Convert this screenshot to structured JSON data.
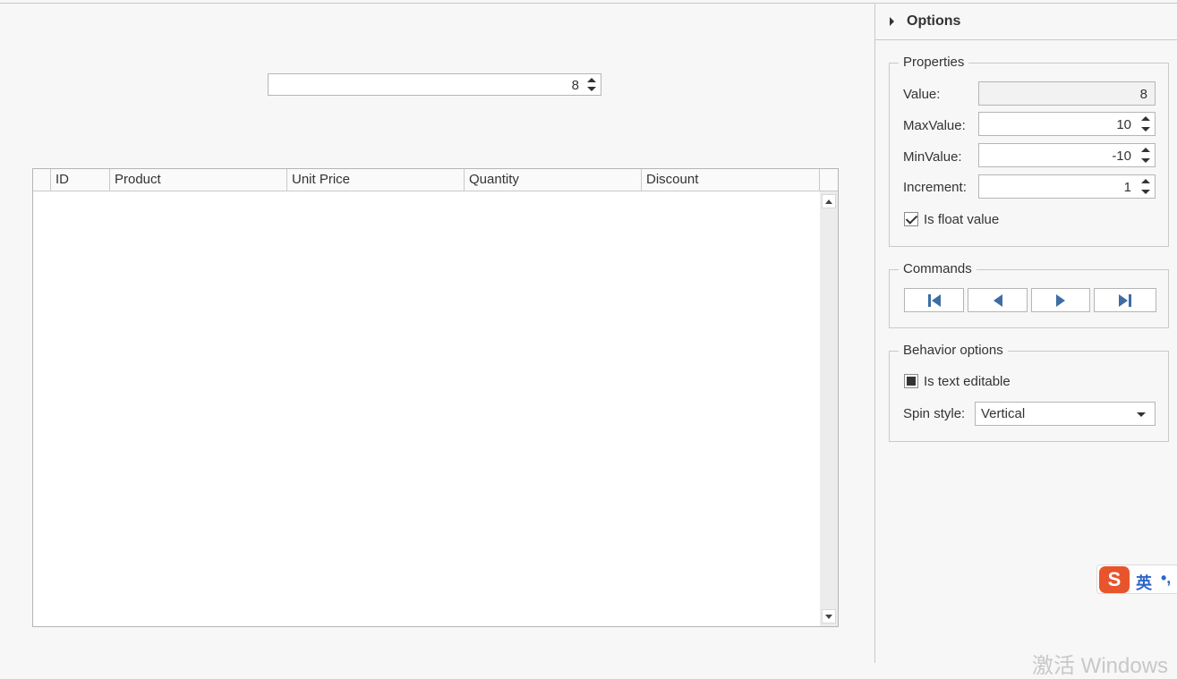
{
  "main": {
    "spin_value": "8"
  },
  "grid": {
    "columns": [
      "",
      "ID",
      "Product",
      "Unit Price",
      "Quantity",
      "Discount"
    ],
    "rows": []
  },
  "options": {
    "title": "Options",
    "properties": {
      "title": "Properties",
      "value_label": "Value:",
      "value": "8",
      "max_label": "MaxValue:",
      "max_value": "10",
      "min_label": "MinValue:",
      "min_value": "-10",
      "increment_label": "Increment:",
      "increment": "1",
      "is_float_label": "Is float value",
      "is_float_checked": true
    },
    "commands": {
      "title": "Commands",
      "buttons": [
        "first-icon",
        "previous-icon",
        "next-icon",
        "last-icon"
      ]
    },
    "behavior": {
      "title": "Behavior options",
      "is_text_editable_label": "Is text editable",
      "is_text_editable_checked": "indeterminate",
      "spin_style_label": "Spin style:",
      "spin_style_value": "Vertical"
    }
  },
  "ime": {
    "logo": "S",
    "mode": "英",
    "punct": "•,"
  },
  "watermark": "激活 Windows",
  "colors": {
    "accent_icon": "#3d6da3",
    "ime_logo": "#e8552d",
    "ime_text": "#2c66c8"
  }
}
